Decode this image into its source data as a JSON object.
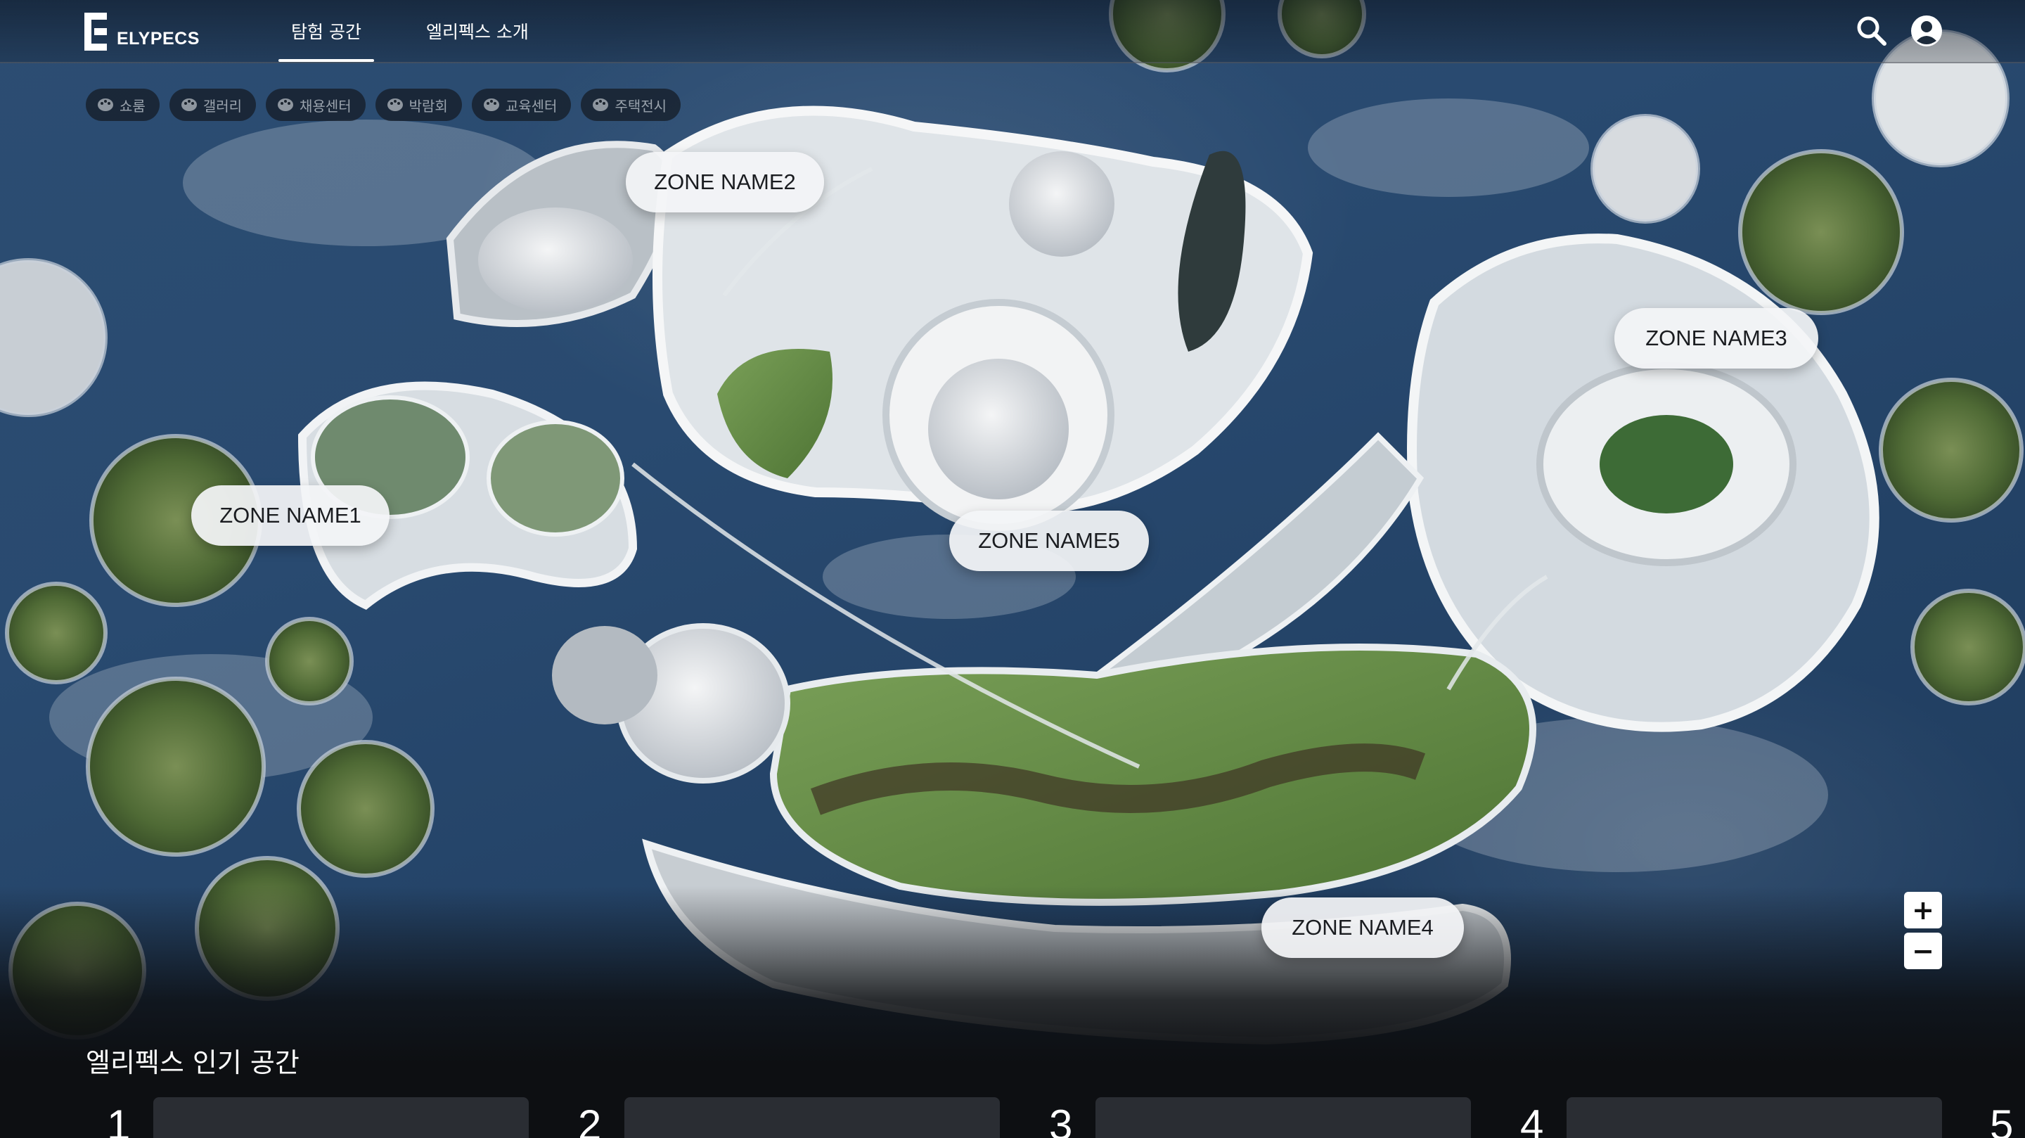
{
  "brand": {
    "name": "ELYPECS"
  },
  "nav": [
    {
      "label": "탐험 공간",
      "active": true
    },
    {
      "label": "엘리펙스 소개",
      "active": false
    }
  ],
  "header_icons": [
    "search-icon",
    "account-icon"
  ],
  "filters": [
    {
      "label": "쇼룸",
      "icon": "palette-icon"
    },
    {
      "label": "갤러리",
      "icon": "palette-icon"
    },
    {
      "label": "채용센터",
      "icon": "palette-icon"
    },
    {
      "label": "박람회",
      "icon": "palette-icon"
    },
    {
      "label": "교육센터",
      "icon": "palette-icon"
    },
    {
      "label": "주택전시",
      "icon": "palette-icon"
    }
  ],
  "zones": [
    {
      "label": "ZONE NAME1"
    },
    {
      "label": "ZONE NAME2"
    },
    {
      "label": "ZONE NAME3"
    },
    {
      "label": "ZONE NAME4"
    },
    {
      "label": "ZONE NAME5"
    }
  ],
  "zoom": {
    "in_label": "+",
    "out_label": "−"
  },
  "popular": {
    "title": "엘리펙스 인기 공간",
    "items": [
      {
        "rank": "1"
      },
      {
        "rank": "2"
      },
      {
        "rank": "3"
      },
      {
        "rank": "4"
      },
      {
        "rank": "5"
      }
    ]
  },
  "colors": {
    "sea": "#294a70",
    "island_green": "#5f7d3e",
    "structure_white": "#e9ecef",
    "label_bg": "#f3f4f6",
    "chip_bg": "#161e28"
  }
}
